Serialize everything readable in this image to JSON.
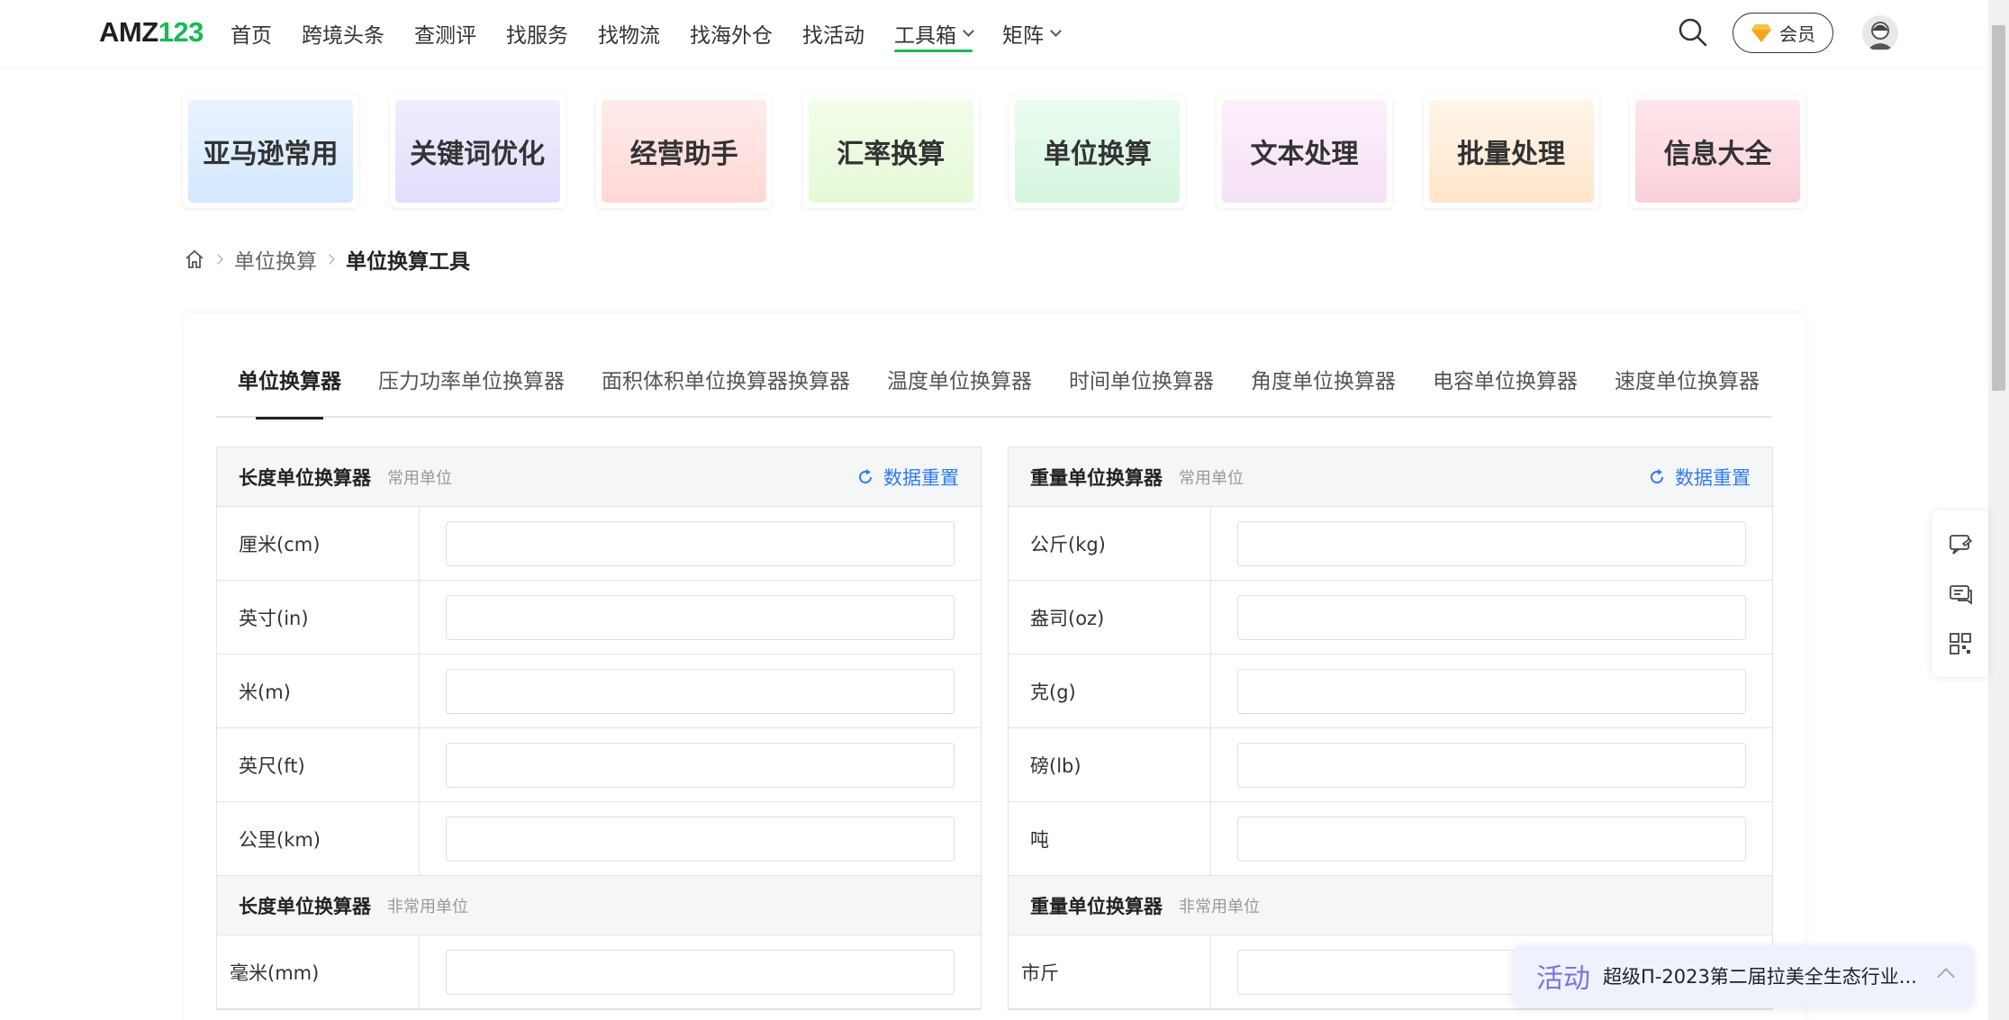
{
  "header": {
    "logo_amz": "AMZ",
    "logo_num": "123",
    "nav": [
      {
        "label": "首页",
        "dropdown": false,
        "active": false
      },
      {
        "label": "跨境头条",
        "dropdown": false,
        "active": false
      },
      {
        "label": "查测评",
        "dropdown": false,
        "active": false
      },
      {
        "label": "找服务",
        "dropdown": false,
        "active": false
      },
      {
        "label": "找物流",
        "dropdown": false,
        "active": false
      },
      {
        "label": "找海外仓",
        "dropdown": false,
        "active": false
      },
      {
        "label": "找活动",
        "dropdown": false,
        "active": false
      },
      {
        "label": "工具箱",
        "dropdown": true,
        "active": true
      },
      {
        "label": "矩阵",
        "dropdown": true,
        "active": false
      }
    ],
    "vip_label": "会员",
    "accent_color": "#19b955"
  },
  "tiles": [
    "亚马逊常用",
    "关键词优化",
    "经营助手",
    "汇率换算",
    "单位换算",
    "文本处理",
    "批量处理",
    "信息大全"
  ],
  "breadcrumb": {
    "level1": "单位换算",
    "current": "单位换算工具"
  },
  "tabs": [
    "单位换算器",
    "压力功率单位换算器",
    "面积体积单位换算器换算器",
    "温度单位换算器",
    "时间单位换算器",
    "角度单位换算器",
    "电容单位换算器",
    "速度单位换算器"
  ],
  "length_panel": {
    "title": "长度单位换算器",
    "subtitle": "常用单位",
    "reset_label": "数据重置",
    "units": [
      "厘米(cm)",
      "英寸(in)",
      "米(m)",
      "英尺(ft)",
      "公里(km)"
    ],
    "uncommon_title": "长度单位换算器",
    "uncommon_subtitle": "非常用单位",
    "uncommon_units": [
      "毫米(mm)"
    ]
  },
  "weight_panel": {
    "title": "重量单位换算器",
    "subtitle": "常用单位",
    "reset_label": "数据重置",
    "units": [
      "公斤(kg)",
      "盎司(oz)",
      "克(g)",
      "磅(lb)",
      "吨"
    ],
    "uncommon_title": "重量单位换算器",
    "uncommon_subtitle": "非常用单位",
    "uncommon_units": [
      "市斤"
    ]
  },
  "activity": {
    "tag": "活动",
    "text": "超级Π-2023第二届拉美全生态行业..."
  }
}
